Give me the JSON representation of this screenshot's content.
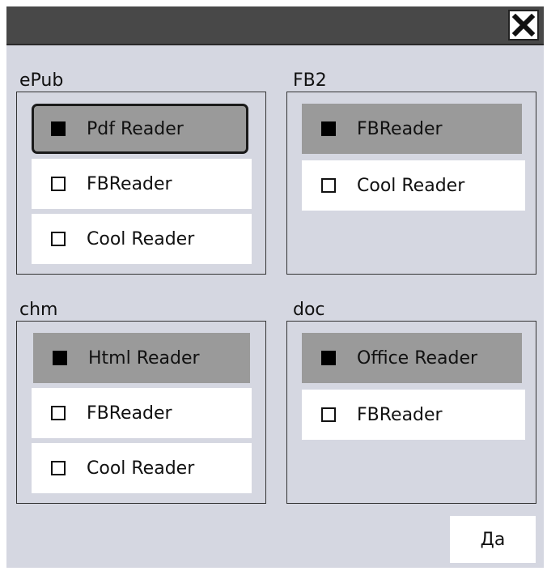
{
  "titlebar": {
    "close_icon": "close-icon"
  },
  "groups": [
    {
      "label": "ePub",
      "options": [
        {
          "label": "Pdf Reader",
          "checked": true
        },
        {
          "label": "FBReader",
          "checked": false
        },
        {
          "label": "Cool Reader",
          "checked": false
        }
      ]
    },
    {
      "label": "FB2",
      "options": [
        {
          "label": "FBReader",
          "checked": true
        },
        {
          "label": "Cool Reader",
          "checked": false
        }
      ]
    },
    {
      "label": "chm",
      "options": [
        {
          "label": "Html Reader",
          "checked": true
        },
        {
          "label": "FBReader",
          "checked": false
        },
        {
          "label": "Cool Reader",
          "checked": false
        }
      ]
    },
    {
      "label": "doc",
      "options": [
        {
          "label": "Office Reader",
          "checked": true
        },
        {
          "label": "FBReader",
          "checked": false
        }
      ]
    }
  ],
  "footer": {
    "ok_label": "Да"
  },
  "colors": {
    "titlebar": "#484848",
    "dialog_bg": "#d5d7e1",
    "selected_option": "#9a9a9a",
    "option_bg": "#ffffff"
  }
}
